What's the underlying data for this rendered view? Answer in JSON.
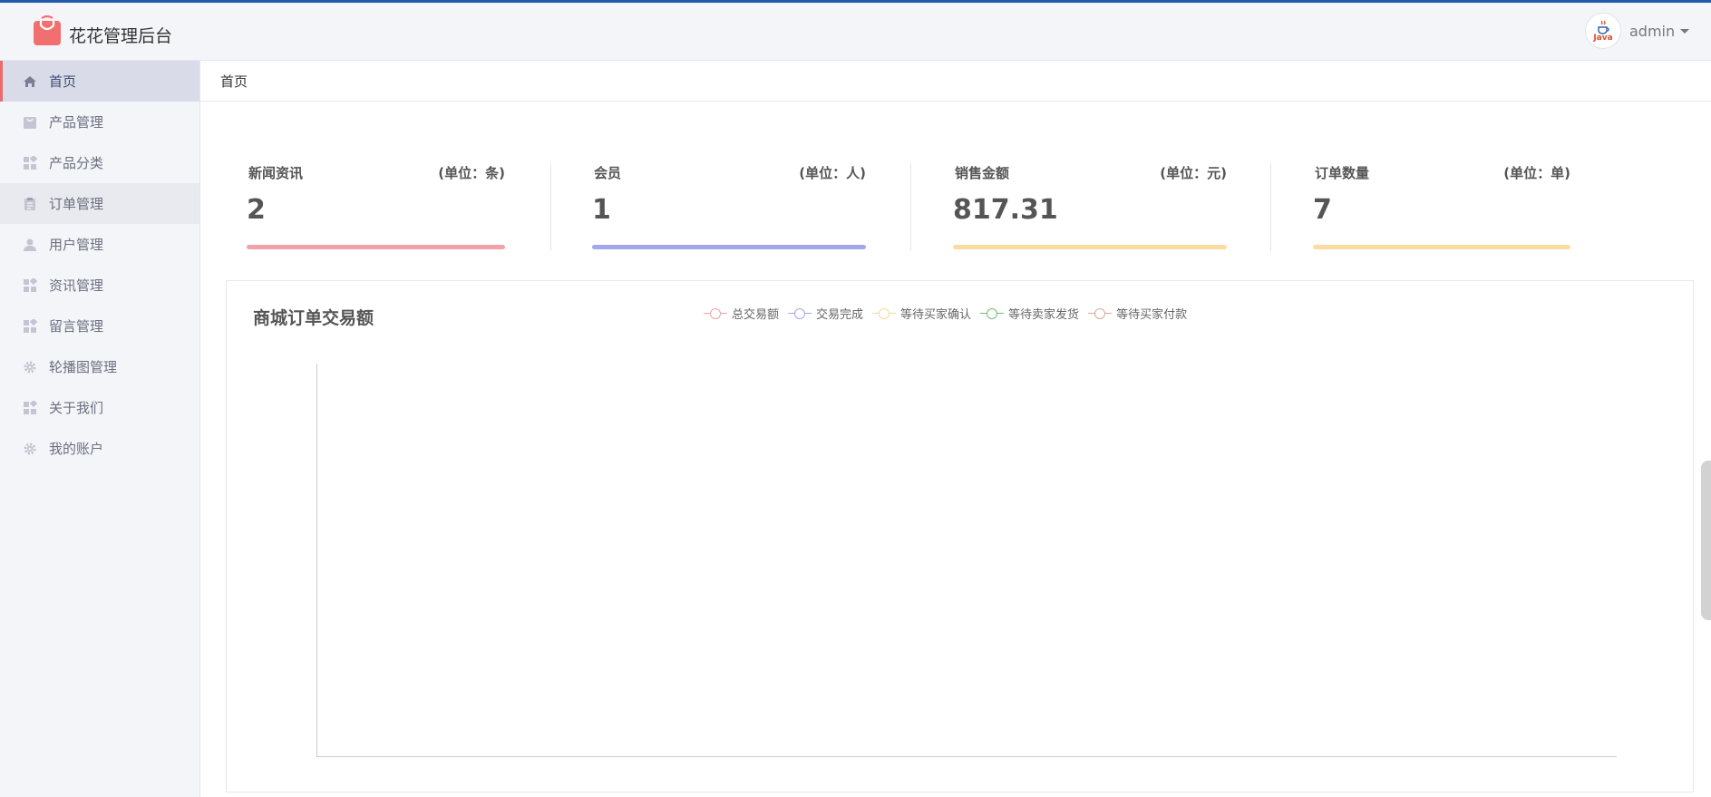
{
  "header": {
    "app_title": "花花管理后台",
    "avatar_text": "Java",
    "username": "admin"
  },
  "sidebar": {
    "items": [
      {
        "label": "首页",
        "icon": "home-icon",
        "active": true
      },
      {
        "label": "产品管理",
        "icon": "bag-icon"
      },
      {
        "label": "产品分类",
        "icon": "grid-icon"
      },
      {
        "label": "订单管理",
        "icon": "clipboard-icon"
      },
      {
        "label": "用户管理",
        "icon": "user-icon"
      },
      {
        "label": "资讯管理",
        "icon": "grid-icon"
      },
      {
        "label": "留言管理",
        "icon": "grid-icon"
      },
      {
        "label": "轮播图管理",
        "icon": "gear-icon"
      },
      {
        "label": "关于我们",
        "icon": "grid-icon"
      },
      {
        "label": "我的账户",
        "icon": "gear-icon"
      }
    ]
  },
  "breadcrumb": "首页",
  "stats": [
    {
      "label": "新闻资讯",
      "unit": "(单位：条)",
      "value": "2",
      "color": "#f2a1a6"
    },
    {
      "label": "会员",
      "unit": "(单位：人)",
      "value": "1",
      "color": "#a3a6eb"
    },
    {
      "label": "销售金额",
      "unit": "(单位：元)",
      "value": "817.31",
      "color": "#fbdca0"
    },
    {
      "label": "订单数量",
      "unit": "(单位：单)",
      "value": "7",
      "color": "#fbdca0"
    }
  ],
  "chart": {
    "title": "商城订单交易额",
    "legend": [
      {
        "name": "总交易额",
        "color": "#f2a1a6"
      },
      {
        "name": "交易完成",
        "color": "#a3a6eb"
      },
      {
        "name": "等待买家确认",
        "color": "#f8d99a"
      },
      {
        "name": "等待卖家发货",
        "color": "#6fbf73"
      },
      {
        "name": "等待买家付款",
        "color": "#d9a99a"
      }
    ]
  },
  "chart_data": {
    "type": "line",
    "title": "商城订单交易额",
    "series": [
      {
        "name": "总交易额",
        "values": []
      },
      {
        "name": "交易完成",
        "values": []
      },
      {
        "name": "等待买家确认",
        "values": []
      },
      {
        "name": "等待卖家发货",
        "values": []
      },
      {
        "name": "等待买家付款",
        "values": []
      }
    ],
    "grid": false,
    "legend_position": "top-center"
  },
  "colors": {
    "accent": "#e86b6b",
    "top_border": "#1e5aa8",
    "logo": "#f26f6f"
  }
}
